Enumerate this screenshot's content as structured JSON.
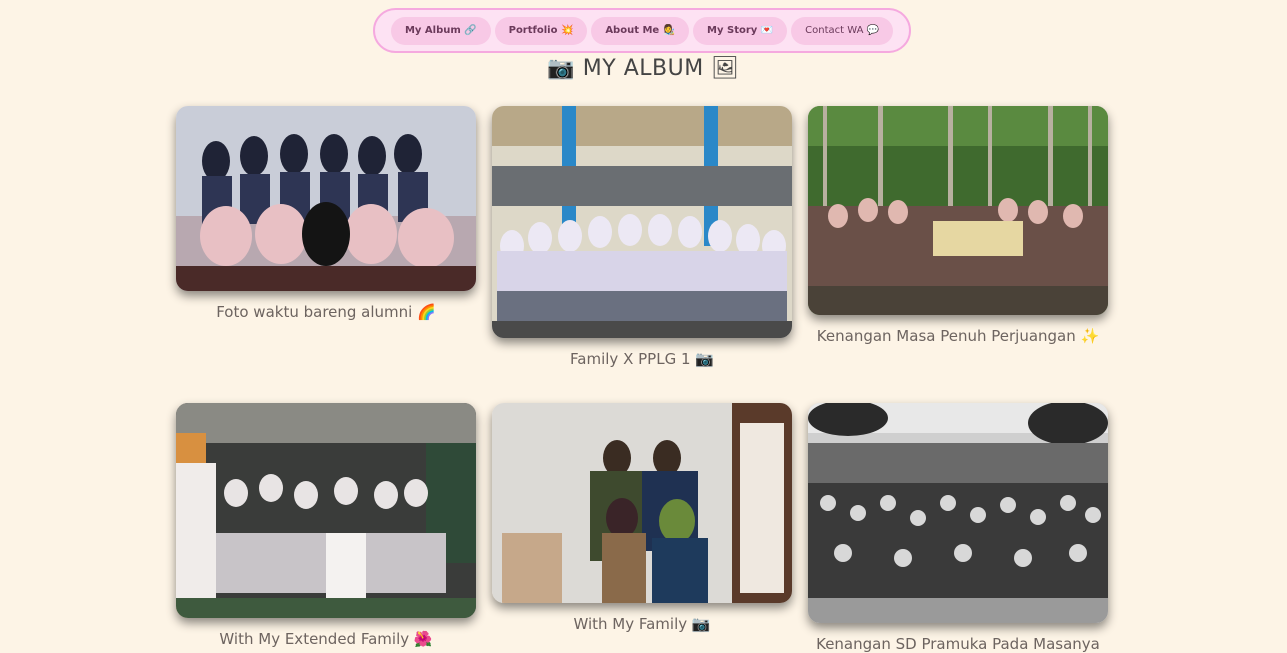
{
  "nav": {
    "items": [
      {
        "label": "My Album 🔗"
      },
      {
        "label": "Portfolio 💥"
      },
      {
        "label": "About Me 👩‍🎨"
      },
      {
        "label": "My Story 💌"
      },
      {
        "label": "Contact WA 💬"
      }
    ],
    "accent_border": "#f5a9df",
    "accent_bg": "#fde2f3",
    "button_bg": "#f8c9e6"
  },
  "page": {
    "title": "📷 MY ALBUM 🖼",
    "background": "#fdf4e6"
  },
  "album": [
    {
      "caption": "Foto waktu bareng alumni 🌈",
      "photo": "group-photo-alumni"
    },
    {
      "caption": "Family X PPLG 1 📷",
      "photo": "group-photo-class"
    },
    {
      "caption": "Kenangan Masa Penuh Perjuangan ✨",
      "photo": "group-photo-scout-forest"
    },
    {
      "caption": "With My Extended Family 🌺",
      "photo": "group-photo-extended-family"
    },
    {
      "caption": "With My Family 📷",
      "photo": "family-photo"
    },
    {
      "caption": "Kenangan SD Pramuka Pada Masanya",
      "photo": "bw-group-photo-scouts"
    }
  ]
}
